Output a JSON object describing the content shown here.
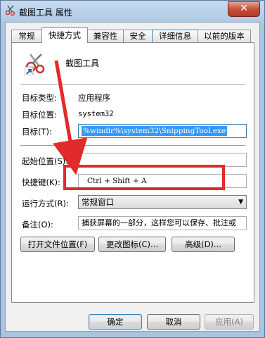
{
  "window": {
    "title": "截图工具 属性",
    "close_label": "✕"
  },
  "tabs": [
    {
      "label": "常规"
    },
    {
      "label": "快捷方式",
      "active": true
    },
    {
      "label": "兼容性"
    },
    {
      "label": "安全"
    },
    {
      "label": "详细信息"
    },
    {
      "label": "以前的版本"
    }
  ],
  "app": {
    "name": "截图工具",
    "icon": "scissors-icon"
  },
  "fields": {
    "target_type_label": "目标类型:",
    "target_type_value": "应用程序",
    "target_location_label": "目标位置:",
    "target_location_value": "system32",
    "target_label": "目标(T):",
    "target_value": "%windir%\\system32\\SnippingTool.exe",
    "start_in_label": "起始位置(S):",
    "start_in_value": "",
    "shortcut_key_label": "快捷键(K):",
    "shortcut_key_value": "Ctrl + Shift + A",
    "run_label": "运行方式(R):",
    "run_value": "常规窗口",
    "comment_label": "备注(O):",
    "comment_value": "捕获屏幕的一部分，这样您可以保存、批注或"
  },
  "buttons": {
    "open_location": "打开文件位置(F)",
    "change_icon": "更改图标(C)...",
    "advanced": "高级(D)...",
    "ok": "确定",
    "cancel": "取消",
    "apply": "应用(A)"
  },
  "colors": {
    "highlight": "#e32a2a",
    "selection": "#3399ff"
  }
}
